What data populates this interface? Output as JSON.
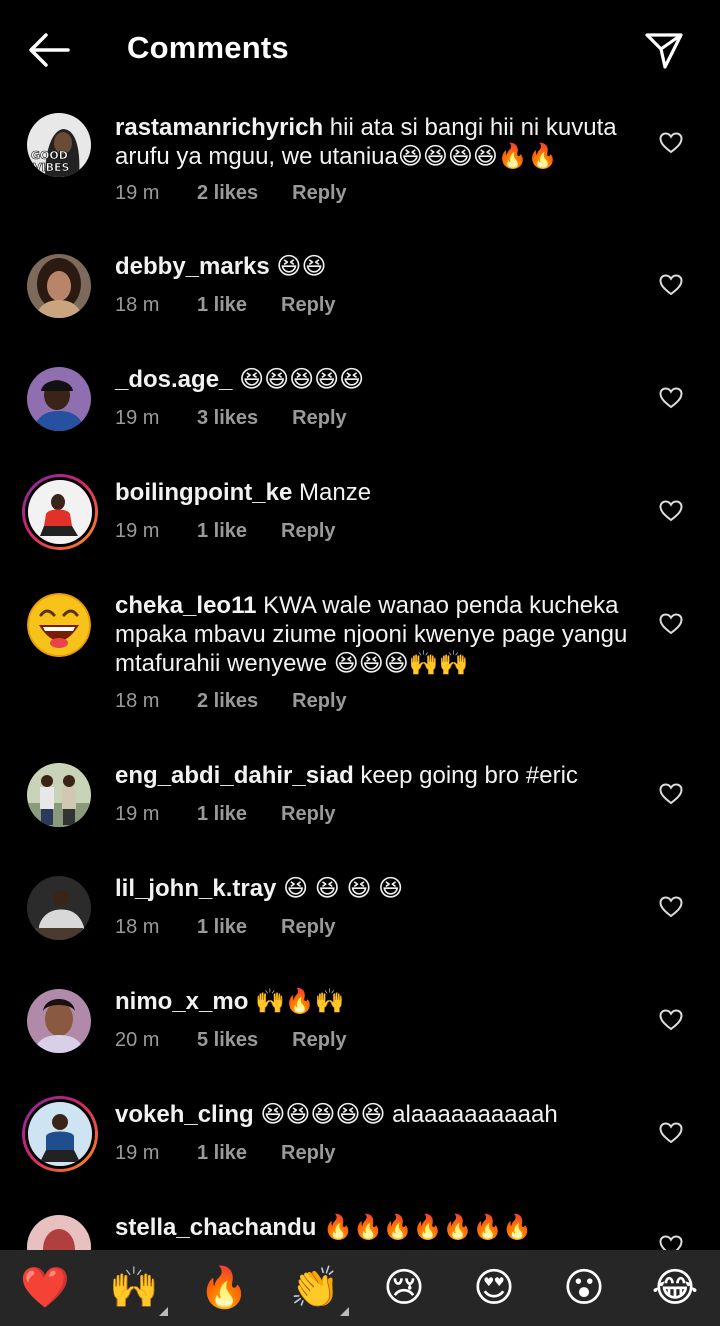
{
  "header": {
    "title": "Comments"
  },
  "comments": [
    {
      "username": "rastamanrichyrich",
      "text": "hii ata si bangi hii ni kuvuta arufu ya mguu, we utaniua😆😆😆😆🔥🔥",
      "time": "19 m",
      "likes": "2 likes",
      "reply": "Reply",
      "avatar_label": "GOOD VIBES"
    },
    {
      "username": "debby_marks",
      "text": "😆😆",
      "time": "18 m",
      "likes": "1 like",
      "reply": "Reply"
    },
    {
      "username": "_dos.age_",
      "text": "😆😆😆😆😆",
      "time": "19 m",
      "likes": "3 likes",
      "reply": "Reply"
    },
    {
      "username": "boilingpoint_ke",
      "text": "Manze",
      "time": "19 m",
      "likes": "1 like",
      "reply": "Reply"
    },
    {
      "username": "cheka_leo11",
      "text": "KWA wale wanao penda kucheka mpaka mbavu ziume njooni kwenye page yangu mtafurahii wenyewe 😆😆😆🙌🙌",
      "time": "18 m",
      "likes": "2 likes",
      "reply": "Reply"
    },
    {
      "username": "eng_abdi_dahir_siad",
      "text": "keep going bro #eric",
      "time": "19 m",
      "likes": "1 like",
      "reply": "Reply"
    },
    {
      "username": "lil_john_k.tray",
      "text": "😆 😆 😆 😆",
      "time": "18 m",
      "likes": "1 like",
      "reply": "Reply"
    },
    {
      "username": "nimo_x_mo",
      "text": "🙌🔥🙌",
      "time": "20 m",
      "likes": "5 likes",
      "reply": "Reply"
    },
    {
      "username": "vokeh_cling",
      "text": "😆😆😆😆😆 alaaaaaaaaaah",
      "time": "19 m",
      "likes": "1 like",
      "reply": "Reply"
    },
    {
      "username": "stella_chachandu",
      "text": "🔥🔥🔥🔥🔥🔥🔥",
      "time": "",
      "likes": "",
      "reply": ""
    }
  ],
  "emoji_bar": [
    "❤️",
    "🙌",
    "🔥",
    "👏",
    "😢",
    "😍",
    "😮",
    "😂"
  ],
  "colors": {
    "background": "#000000",
    "meta": "#9a9a9a",
    "emoji_bar_bg": "#262626"
  }
}
